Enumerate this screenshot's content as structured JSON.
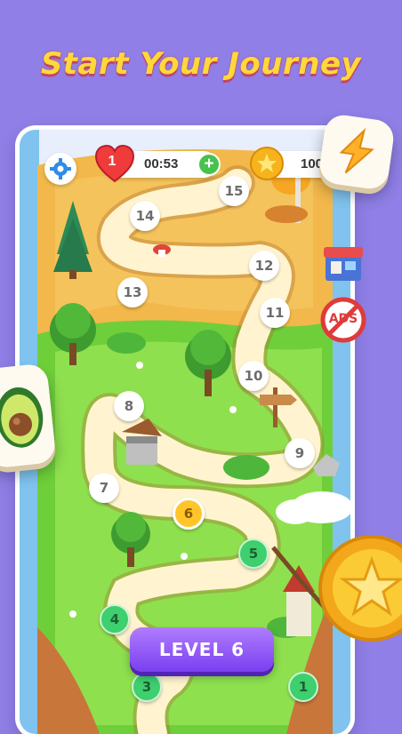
{
  "headline": "Start Your Journey",
  "hud": {
    "lives": "1",
    "timer": "00:53",
    "coins": "100",
    "add_lives_label": "+"
  },
  "side_icons": {
    "no_ads_label": "ADS"
  },
  "levels": [
    {
      "number": "15",
      "state": "locked"
    },
    {
      "number": "14",
      "state": "locked"
    },
    {
      "number": "13",
      "state": "locked"
    },
    {
      "number": "12",
      "state": "locked"
    },
    {
      "number": "11",
      "state": "locked"
    },
    {
      "number": "10",
      "state": "locked"
    },
    {
      "number": "9",
      "state": "locked"
    },
    {
      "number": "8",
      "state": "locked"
    },
    {
      "number": "7",
      "state": "locked"
    },
    {
      "number": "6",
      "state": "current"
    },
    {
      "number": "5",
      "state": "done"
    },
    {
      "number": "4",
      "state": "done"
    },
    {
      "number": "3",
      "state": "done"
    },
    {
      "number": "1",
      "state": "done"
    }
  ],
  "play_button": "LEVEL 6",
  "colors": {
    "background": "#8f7fe6",
    "headline": "#ffd83a",
    "button": "#8b4ff5",
    "completed_level": "#3ecf6e",
    "current_level": "#ffc52b"
  }
}
